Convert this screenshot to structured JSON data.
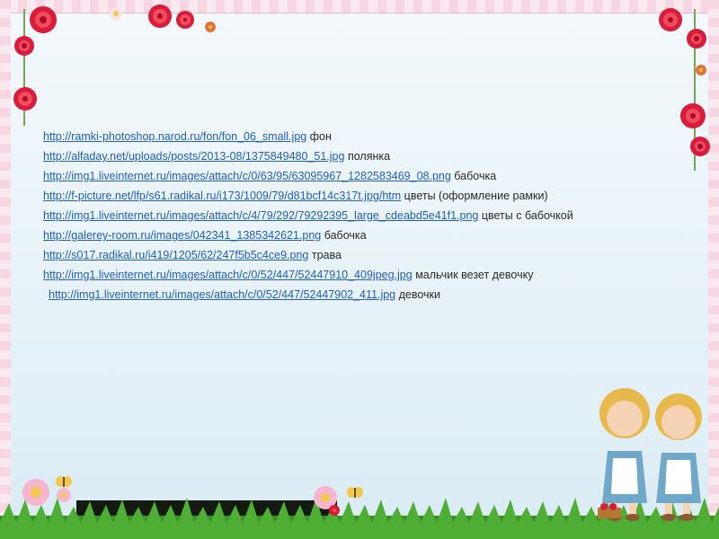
{
  "slide": {
    "links": [
      {
        "url": "http://ramki-photoshop.narod.ru/fon/fon_06_small.jpg",
        "desc": "фон"
      },
      {
        "url": "http://alfaday.net/uploads/posts/2013-08/1375849480_51.jpg",
        "desc": "полянка"
      },
      {
        "url": "http://img1.liveinternet.ru/images/attach/c/0/63/95/63095967_1282583469_08.png",
        "desc": "бабочка"
      },
      {
        "url": "http://f-picture.net/lfp/s61.radikal.ru/i173/1009/79/d81bcf14c317t.jpg/htm",
        "desc": "цветы (оформление рамки)"
      },
      {
        "url": "http://img1.liveinternet.ru/images/attach/c/4/79/292/79292395_large_cdeabd5e41f1.png",
        "desc": "цветы с бабочкой"
      },
      {
        "url": "http://galerey-room.ru/images/042341_1385342621.png",
        "desc": "бабочка"
      },
      {
        "url": "http://s017.radikal.ru/i419/1205/62/247f5b5c4ce9.png",
        "desc": "трава"
      },
      {
        "url": "http://img1.liveinternet.ru/images/attach/c/0/52/447/52447910_409jpeg.jpg",
        "desc": "мальчик везет девочку"
      },
      {
        "url": "http://img1.liveinternet.ru/images/attach/c/0/52/447/52447902_411.jpg",
        "desc": "девочки"
      }
    ]
  },
  "decor": {
    "icons": [
      "rose-icon",
      "butterfly-icon",
      "daisy-icon",
      "grass-icon",
      "girls-illustration"
    ]
  }
}
